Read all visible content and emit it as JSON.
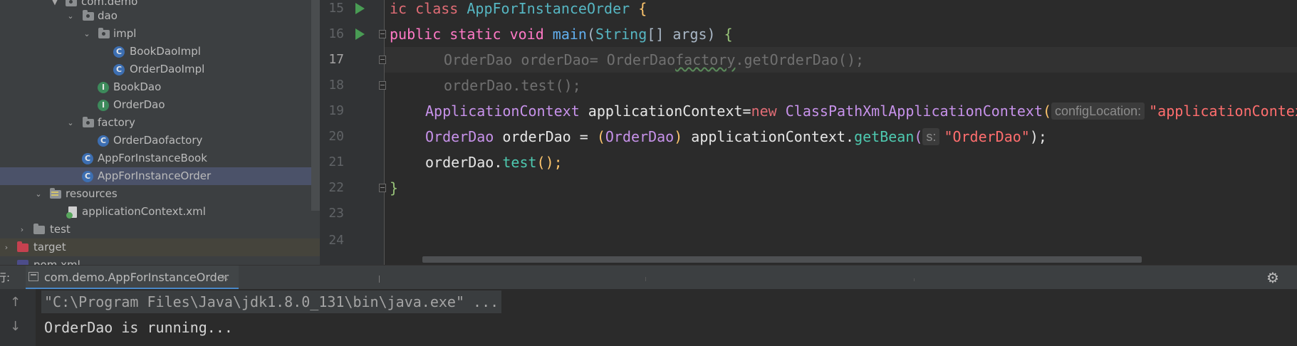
{
  "project_tree": {
    "items": [
      {
        "label": "com.demo",
        "kind": "package"
      },
      {
        "label": "dao",
        "kind": "package"
      },
      {
        "label": "impl",
        "kind": "package"
      },
      {
        "label": "BookDaoImpl",
        "kind": "class",
        "icon_letter": "C"
      },
      {
        "label": "OrderDaoImpl",
        "kind": "class",
        "icon_letter": "C"
      },
      {
        "label": "BookDao",
        "kind": "interface",
        "icon_letter": "I"
      },
      {
        "label": "OrderDao",
        "kind": "interface",
        "icon_letter": "I"
      },
      {
        "label": "factory",
        "kind": "package"
      },
      {
        "label": "OrderDaofactory",
        "kind": "class",
        "icon_letter": "C"
      },
      {
        "label": "AppForInstanceBook",
        "kind": "class",
        "icon_letter": "C"
      },
      {
        "label": "AppForInstanceOrder",
        "kind": "class",
        "icon_letter": "C",
        "selected": true
      },
      {
        "label": "resources",
        "kind": "resource-folder"
      },
      {
        "label": "applicationContext.xml",
        "kind": "xml-file"
      },
      {
        "label": "test",
        "kind": "folder"
      },
      {
        "label": "target",
        "kind": "excluded-folder"
      },
      {
        "label": "pom.xml",
        "kind": "file"
      }
    ]
  },
  "editor": {
    "current_line": 17,
    "lines": [
      {
        "num": "15"
      },
      {
        "num": "16"
      },
      {
        "num": "17"
      },
      {
        "num": "18"
      },
      {
        "num": "19"
      },
      {
        "num": "20"
      },
      {
        "num": "21"
      },
      {
        "num": "22"
      },
      {
        "num": "23"
      },
      {
        "num": "24"
      }
    ],
    "code": {
      "l15_kw": "ic class ",
      "l15_cls": "AppForInstanceOrder",
      "l15_brace": " {",
      "l16_kw": "public static void ",
      "l16_fn": "main",
      "l16_p1": "(",
      "l16_type": "String",
      "l16_p2": "[] args) ",
      "l16_brace": "{",
      "l17_a": "OrderDao orderDao= OrderDao",
      "l17_b": "factory",
      "l17_c": ".getOrderDao();",
      "l18": "orderDao.test();",
      "l19_type": "ApplicationContext",
      "l19_var": " applicationContext=",
      "l19_new": "new ",
      "l19_cls": "ClassPathXmlApplicationContext",
      "l19_paren": "(",
      "l19_hint": "configLocation:",
      "l19_str": "\"applicationContext.xml\");",
      "l20_type": "OrderDao",
      "l20_var": " orderDao = ",
      "l20_p1": "(",
      "l20_cast": "OrderDao",
      "l20_p2": ")",
      "l20_mid": " applicationContext.",
      "l20_fn": "getBean",
      "l20_p3": "(",
      "l20_hint": "s:",
      "l20_str": "\"OrderDao\"",
      "l20_end": ");",
      "l21_var": "orderDao.",
      "l21_fn": "test",
      "l21_end": "();",
      "l22": "}"
    }
  },
  "run_panel": {
    "label": "行:",
    "tab_label": "com.demo.AppForInstanceOrder",
    "close_glyph": "×",
    "gear_glyph": "⚙",
    "up_glyph": "↑",
    "down_glyph": "↓",
    "console": [
      "\"C:\\Program Files\\Java\\jdk1.8.0_131\\bin\\java.exe\" ...",
      "OrderDao is running..."
    ]
  },
  "colors": {
    "run_icon": "#499c54",
    "selection": "#4b5269",
    "tab_underline": "#4a88c7"
  }
}
